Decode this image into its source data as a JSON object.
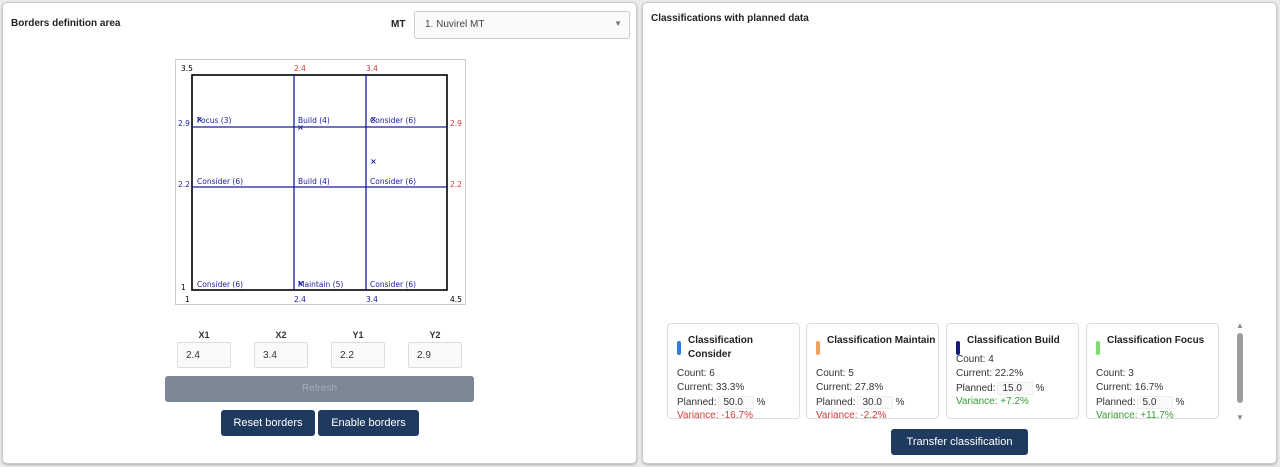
{
  "left": {
    "title": "Borders definition area",
    "mt_label": "MT",
    "mt_selected": "1. Nuvirel MT",
    "plot": {
      "top_labels": [
        "3.5",
        "2.4",
        "3.4"
      ],
      "bottom_labels": [
        "1",
        "2.4",
        "3.4",
        "4.5"
      ],
      "left_labels": [
        "2.9",
        "2.2",
        "1"
      ],
      "right_labels": [
        "2.9",
        "2.2"
      ],
      "cells": [
        "Focus (3)",
        "Build (4)",
        "Consider (6)",
        "Consider (6)",
        "Build (4)",
        "Consider (6)",
        "Consider (6)",
        "Maintain (5)",
        "Consider (6)"
      ],
      "marker": "×"
    },
    "coords": {
      "x1": {
        "label": "X1",
        "value": "2.4"
      },
      "x2": {
        "label": "X2",
        "value": "3.4"
      },
      "y1": {
        "label": "Y1",
        "value": "2.2"
      },
      "y2": {
        "label": "Y2",
        "value": "2.9"
      }
    },
    "refresh_label": "Refresh",
    "reset_label": "Reset borders",
    "enable_label": "Enable borders"
  },
  "right": {
    "title": "Classifications with planned data",
    "cards": [
      {
        "title": "Classification Consider",
        "color": "#2b7de1",
        "count": "Count: 6",
        "current": "Current: 33.3%",
        "planned_label": "Planned:",
        "planned": "50.0",
        "pct": "%",
        "variance": "Variance: -16.7%"
      },
      {
        "title": "Classification Maintain",
        "color": "#f0a05a",
        "count": "Count: 5",
        "current": "Current: 27.8%",
        "planned_label": "Planned:",
        "planned": "30.0",
        "pct": "%",
        "variance": "Variance: -2.2%"
      },
      {
        "title": "Classification Build",
        "color": "#141a7a",
        "count": "Count: 4",
        "current": "Current: 22.2%",
        "planned_label": "Planned:",
        "planned": "15.0",
        "pct": "%",
        "variance": "Variance: +7.2%"
      },
      {
        "title": "Classification Focus",
        "color": "#7bdd6e",
        "count": "Count: 3",
        "current": "Current: 16.7%",
        "planned_label": "Planned:",
        "planned": "5.0",
        "pct": "%",
        "variance": "Variance: +11.7%"
      }
    ],
    "transfer_label": "Transfer classification"
  }
}
